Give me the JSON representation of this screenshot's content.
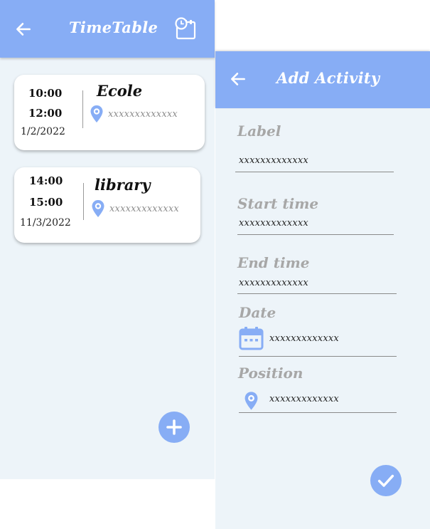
{
  "timetable": {
    "title": "TimeTable",
    "activities": [
      {
        "start": "10:00",
        "end": "12:00",
        "date": "1/2/2022",
        "label": "Ecole",
        "position": "xxxxxxxxxxxxx"
      },
      {
        "start": "14:00",
        "end": "15:00",
        "date": "11/3/2022",
        "label": "library",
        "position": "xxxxxxxxxxxxx"
      }
    ]
  },
  "add_activity": {
    "title": "Add Activity",
    "fields": {
      "label": {
        "label": "Label",
        "value": "xxxxxxxxxxxxx"
      },
      "start_time": {
        "label": "Start time",
        "value": "xxxxxxxxxxxxx"
      },
      "end_time": {
        "label": "End time",
        "value": "xxxxxxxxxxxxx"
      },
      "date": {
        "label": "Date",
        "value": "xxxxxxxxxxxxx"
      },
      "position": {
        "label": "Position",
        "value": "xxxxxxxxxxxxx"
      }
    }
  },
  "icons": {
    "back": "arrow-left-icon",
    "schedule": "schedule-icon",
    "location": "location-pin-icon",
    "calendar": "calendar-icon",
    "add": "plus-icon",
    "confirm": "check-icon"
  },
  "colors": {
    "primary": "#87adf5",
    "background": "#edf4f9",
    "card": "#ffffff",
    "muted_label": "#a7a7a7"
  }
}
